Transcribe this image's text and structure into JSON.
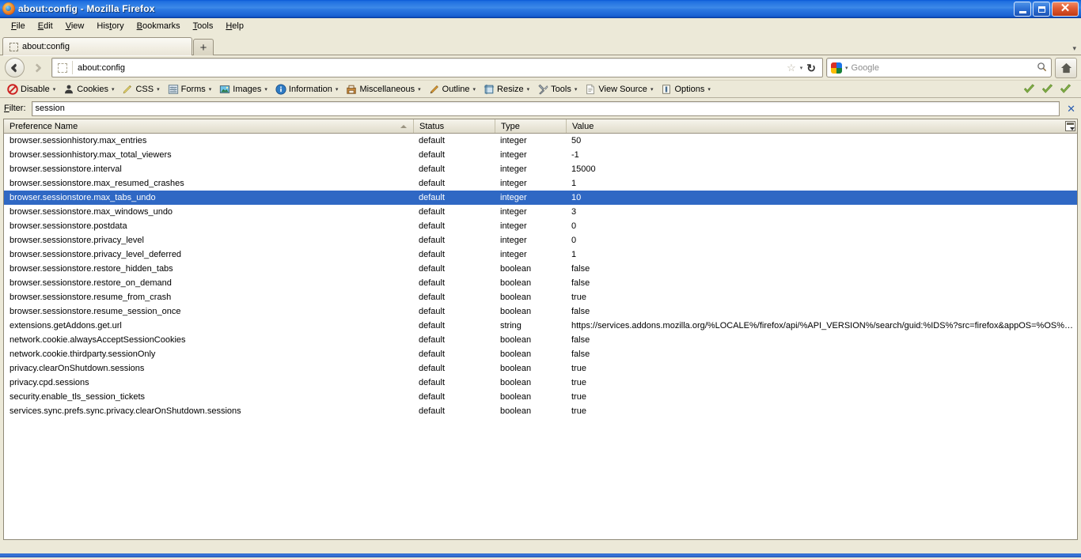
{
  "window": {
    "title": "about:config - Mozilla Firefox",
    "logo_icon": "firefox-logo-icon",
    "minimize_label": "",
    "maximize_label": "",
    "close_label": "✕"
  },
  "menubar": {
    "items": [
      {
        "label": "File",
        "accel": "F",
        "rest": "ile"
      },
      {
        "label": "Edit",
        "accel": "E",
        "rest": "dit"
      },
      {
        "label": "View",
        "accel": "V",
        "rest": "iew"
      },
      {
        "label": "History",
        "accel": "H",
        "rest": "istory"
      },
      {
        "label": "Bookmarks",
        "accel": "B",
        "rest": "ookmarks"
      },
      {
        "label": "Tools",
        "accel": "T",
        "rest": "ools"
      },
      {
        "label": "Help",
        "accel": "H",
        "rest": "elp"
      }
    ]
  },
  "tabstrip": {
    "tab_label": "about:config",
    "new_tab_label": "+",
    "list_all_tabs_label": "▾"
  },
  "navbar": {
    "back_label": "←",
    "forward_label": "→",
    "url_value": "about:config",
    "bookmark_star": "☆",
    "bookmark_caret": "▾",
    "reload_label": "↻",
    "search_placeholder": "Google",
    "search_caret": "▾",
    "magnifier_label": "⌕",
    "home_label": "⌂"
  },
  "devtoolbar": {
    "items": [
      {
        "label": "Disable",
        "icon": "disable-icon",
        "caret": "▾"
      },
      {
        "label": "Cookies",
        "icon": "cookies-icon",
        "caret": "▾"
      },
      {
        "label": "CSS",
        "icon": "css-icon",
        "caret": "▾"
      },
      {
        "label": "Forms",
        "icon": "forms-icon",
        "caret": "▾"
      },
      {
        "label": "Images",
        "icon": "images-icon",
        "caret": "▾"
      },
      {
        "label": "Information",
        "icon": "information-icon",
        "caret": "▾"
      },
      {
        "label": "Miscellaneous",
        "icon": "miscellaneous-icon",
        "caret": "▾"
      },
      {
        "label": "Outline",
        "icon": "outline-icon",
        "caret": "▾"
      },
      {
        "label": "Resize",
        "icon": "resize-icon",
        "caret": "▾"
      },
      {
        "label": "Tools",
        "icon": "tools-icon",
        "caret": "▾"
      },
      {
        "label": "View Source",
        "icon": "view-source-icon",
        "caret": "▾"
      },
      {
        "label": "Options",
        "icon": "options-icon",
        "caret": "▾"
      }
    ],
    "validators": [
      "html-validation-check-icon",
      "css-validation-check-icon",
      "accessibility-validation-check-icon"
    ]
  },
  "filter": {
    "label_accel": "F",
    "label_rest": "ilter:",
    "value": "session",
    "placeholder": "",
    "clear_label": "✕"
  },
  "table": {
    "columns": {
      "name": "Preference Name",
      "status": "Status",
      "type": "Type",
      "value": "Value"
    },
    "sort_column": "name",
    "sort_direction": "ascending",
    "selected_index": 4,
    "rows": [
      {
        "name": "browser.sessionhistory.max_entries",
        "status": "default",
        "type": "integer",
        "value": "50"
      },
      {
        "name": "browser.sessionhistory.max_total_viewers",
        "status": "default",
        "type": "integer",
        "value": "-1"
      },
      {
        "name": "browser.sessionstore.interval",
        "status": "default",
        "type": "integer",
        "value": "15000"
      },
      {
        "name": "browser.sessionstore.max_resumed_crashes",
        "status": "default",
        "type": "integer",
        "value": "1"
      },
      {
        "name": "browser.sessionstore.max_tabs_undo",
        "status": "default",
        "type": "integer",
        "value": "10"
      },
      {
        "name": "browser.sessionstore.max_windows_undo",
        "status": "default",
        "type": "integer",
        "value": "3"
      },
      {
        "name": "browser.sessionstore.postdata",
        "status": "default",
        "type": "integer",
        "value": "0"
      },
      {
        "name": "browser.sessionstore.privacy_level",
        "status": "default",
        "type": "integer",
        "value": "0"
      },
      {
        "name": "browser.sessionstore.privacy_level_deferred",
        "status": "default",
        "type": "integer",
        "value": "1"
      },
      {
        "name": "browser.sessionstore.restore_hidden_tabs",
        "status": "default",
        "type": "boolean",
        "value": "false"
      },
      {
        "name": "browser.sessionstore.restore_on_demand",
        "status": "default",
        "type": "boolean",
        "value": "false"
      },
      {
        "name": "browser.sessionstore.resume_from_crash",
        "status": "default",
        "type": "boolean",
        "value": "true"
      },
      {
        "name": "browser.sessionstore.resume_session_once",
        "status": "default",
        "type": "boolean",
        "value": "false"
      },
      {
        "name": "extensions.getAddons.get.url",
        "status": "default",
        "type": "string",
        "value": "https://services.addons.mozilla.org/%LOCALE%/firefox/api/%API_VERSION%/search/guid:%IDS%?src=firefox&appOS=%OS%&..."
      },
      {
        "name": "network.cookie.alwaysAcceptSessionCookies",
        "status": "default",
        "type": "boolean",
        "value": "false"
      },
      {
        "name": "network.cookie.thirdparty.sessionOnly",
        "status": "default",
        "type": "boolean",
        "value": "false"
      },
      {
        "name": "privacy.clearOnShutdown.sessions",
        "status": "default",
        "type": "boolean",
        "value": "true"
      },
      {
        "name": "privacy.cpd.sessions",
        "status": "default",
        "type": "boolean",
        "value": "true"
      },
      {
        "name": "security.enable_tls_session_tickets",
        "status": "default",
        "type": "boolean",
        "value": "true"
      },
      {
        "name": "services.sync.prefs.sync.privacy.clearOnShutdown.sessions",
        "status": "default",
        "type": "boolean",
        "value": "true"
      }
    ]
  },
  "statusbar": {
    "text": ""
  },
  "colors": {
    "titlebar_blue": "#1f6fe0",
    "selection_blue": "#2f68c4",
    "chrome_beige": "#ece9d8",
    "clear_x_blue": "#2a5db0"
  }
}
